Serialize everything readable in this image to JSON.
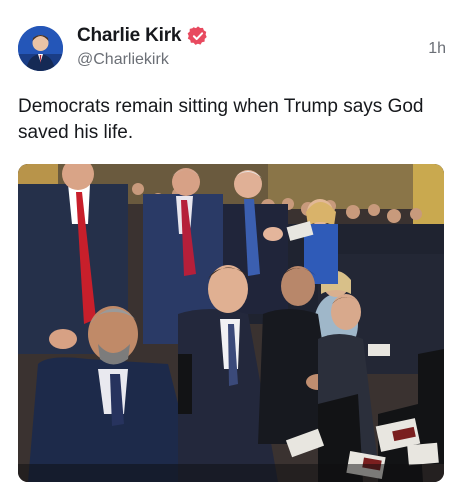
{
  "post": {
    "author_name": "Charlie Kirk",
    "author_handle": "@Charliekirk",
    "timestamp": "1h",
    "text": "Democrats remain sitting when Trump says God saved his life."
  },
  "icons": {
    "verified": "verified-badge-icon",
    "avatar": "avatar"
  },
  "colors": {
    "verified_badge": "#e84a5f",
    "text_primary": "#16181c",
    "text_secondary": "#6b6f76"
  }
}
